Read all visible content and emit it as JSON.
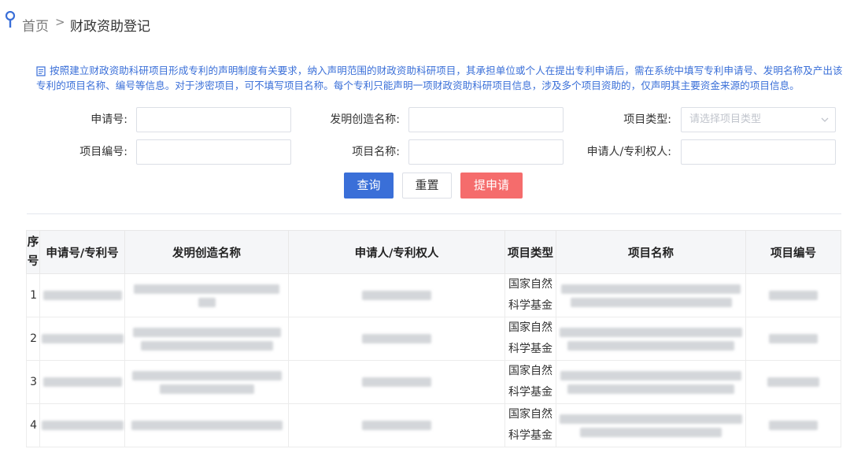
{
  "breadcrumb": {
    "home": "首页",
    "separator": ">",
    "current": "财政资助登记"
  },
  "notice": "按照建立财政资助科研项目形成专利的声明制度有关要求，纳入声明范围的财政资助科研项目，其承担单位或个人在提出专利申请后，需在系统中填写专利申请号、发明名称及产出该专利的项目名称、编号等信息。对于涉密项目，可不填写项目名称。每个专利只能声明一项财政资助科研项目信息，涉及多个项目资助的，仅声明其主要资金来源的项目信息。",
  "form": {
    "application_no_label": "申请号:",
    "invention_name_label": "发明创造名称:",
    "project_type_label": "项目类型:",
    "project_type_placeholder": "请选择项目类型",
    "project_no_label": "项目编号:",
    "project_name_label": "项目名称:",
    "applicant_label": "申请人/专利权人:"
  },
  "buttons": {
    "query": "查询",
    "reset": "重置",
    "submit": "提申请"
  },
  "table": {
    "columns": [
      "序号",
      "申请号/专利号",
      "发明创造名称",
      "申请人/专利权人",
      "项目类型",
      "项目名称",
      "项目编号"
    ],
    "rows": [
      {
        "seq": "1",
        "type_line1": "国家自然",
        "type_line2": "科学基金"
      },
      {
        "seq": "2",
        "type_line1": "国家自然",
        "type_line2": "科学基金"
      },
      {
        "seq": "3",
        "type_line1": "国家自然",
        "type_line2": "科学基金"
      },
      {
        "seq": "4",
        "type_line1": "国家自然",
        "type_line2": "科学基金"
      }
    ]
  },
  "colors": {
    "primary": "#3a6fd8",
    "danger": "#f56c6c",
    "notice_text": "#3a6fd8"
  }
}
